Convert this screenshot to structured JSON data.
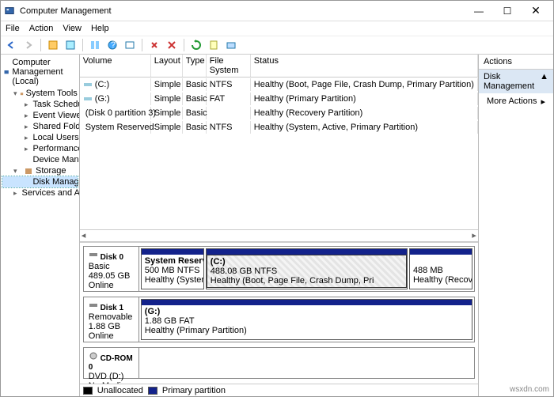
{
  "window": {
    "title": "Computer Management"
  },
  "window_controls": {
    "min": "—",
    "max": "☐",
    "close": "✕"
  },
  "menu": {
    "file": "File",
    "action": "Action",
    "view": "View",
    "help": "Help"
  },
  "tree": {
    "root": "Computer Management (Local)",
    "system_tools": "System Tools",
    "task_scheduler": "Task Scheduler",
    "event_viewer": "Event Viewer",
    "shared_folders": "Shared Folders",
    "local_users": "Local Users and Groups",
    "performance": "Performance",
    "device_manager": "Device Manager",
    "storage": "Storage",
    "disk_management": "Disk Management",
    "services": "Services and Applications"
  },
  "columns": {
    "volume": "Volume",
    "layout": "Layout",
    "type": "Type",
    "fs": "File System",
    "status": "Status"
  },
  "vols": [
    {
      "name": "(C:)",
      "layout": "Simple",
      "type": "Basic",
      "fs": "NTFS",
      "status": "Healthy (Boot, Page File, Crash Dump, Primary Partition)"
    },
    {
      "name": "(G:)",
      "layout": "Simple",
      "type": "Basic",
      "fs": "FAT",
      "status": "Healthy (Primary Partition)"
    },
    {
      "name": "(Disk 0 partition 3)",
      "layout": "Simple",
      "type": "Basic",
      "fs": "",
      "status": "Healthy (Recovery Partition)"
    },
    {
      "name": "System Reserved",
      "layout": "Simple",
      "type": "Basic",
      "fs": "NTFS",
      "status": "Healthy (System, Active, Primary Partition)"
    }
  ],
  "disk0": {
    "label": "Disk 0",
    "kind": "Basic",
    "size": "489.05 GB",
    "state": "Online",
    "p0": {
      "title": "System Reserved",
      "l1": "500 MB NTFS",
      "l2": "Healthy (System, A"
    },
    "p1": {
      "title": "(C:)",
      "l1": "488.08 GB NTFS",
      "l2": "Healthy (Boot, Page File, Crash Dump, Pri"
    },
    "p2": {
      "title": "",
      "l1": "488 MB",
      "l2": "Healthy (Recovery"
    }
  },
  "disk1": {
    "label": "Disk 1",
    "kind": "Removable",
    "size": "1.88 GB",
    "state": "Online",
    "p0": {
      "title": "(G:)",
      "l1": "1.88 GB FAT",
      "l2": "Healthy (Primary Partition)"
    }
  },
  "cdrom": {
    "label": "CD-ROM 0",
    "kind": "DVD (D:)",
    "state": "No Media"
  },
  "legend": {
    "unalloc": "Unallocated",
    "primary": "Primary partition"
  },
  "actions": {
    "header": "Actions",
    "selected": "Disk Management",
    "caret": "▲",
    "more": "More Actions",
    "more_caret": "▸"
  },
  "footer": "wsxdn.com"
}
